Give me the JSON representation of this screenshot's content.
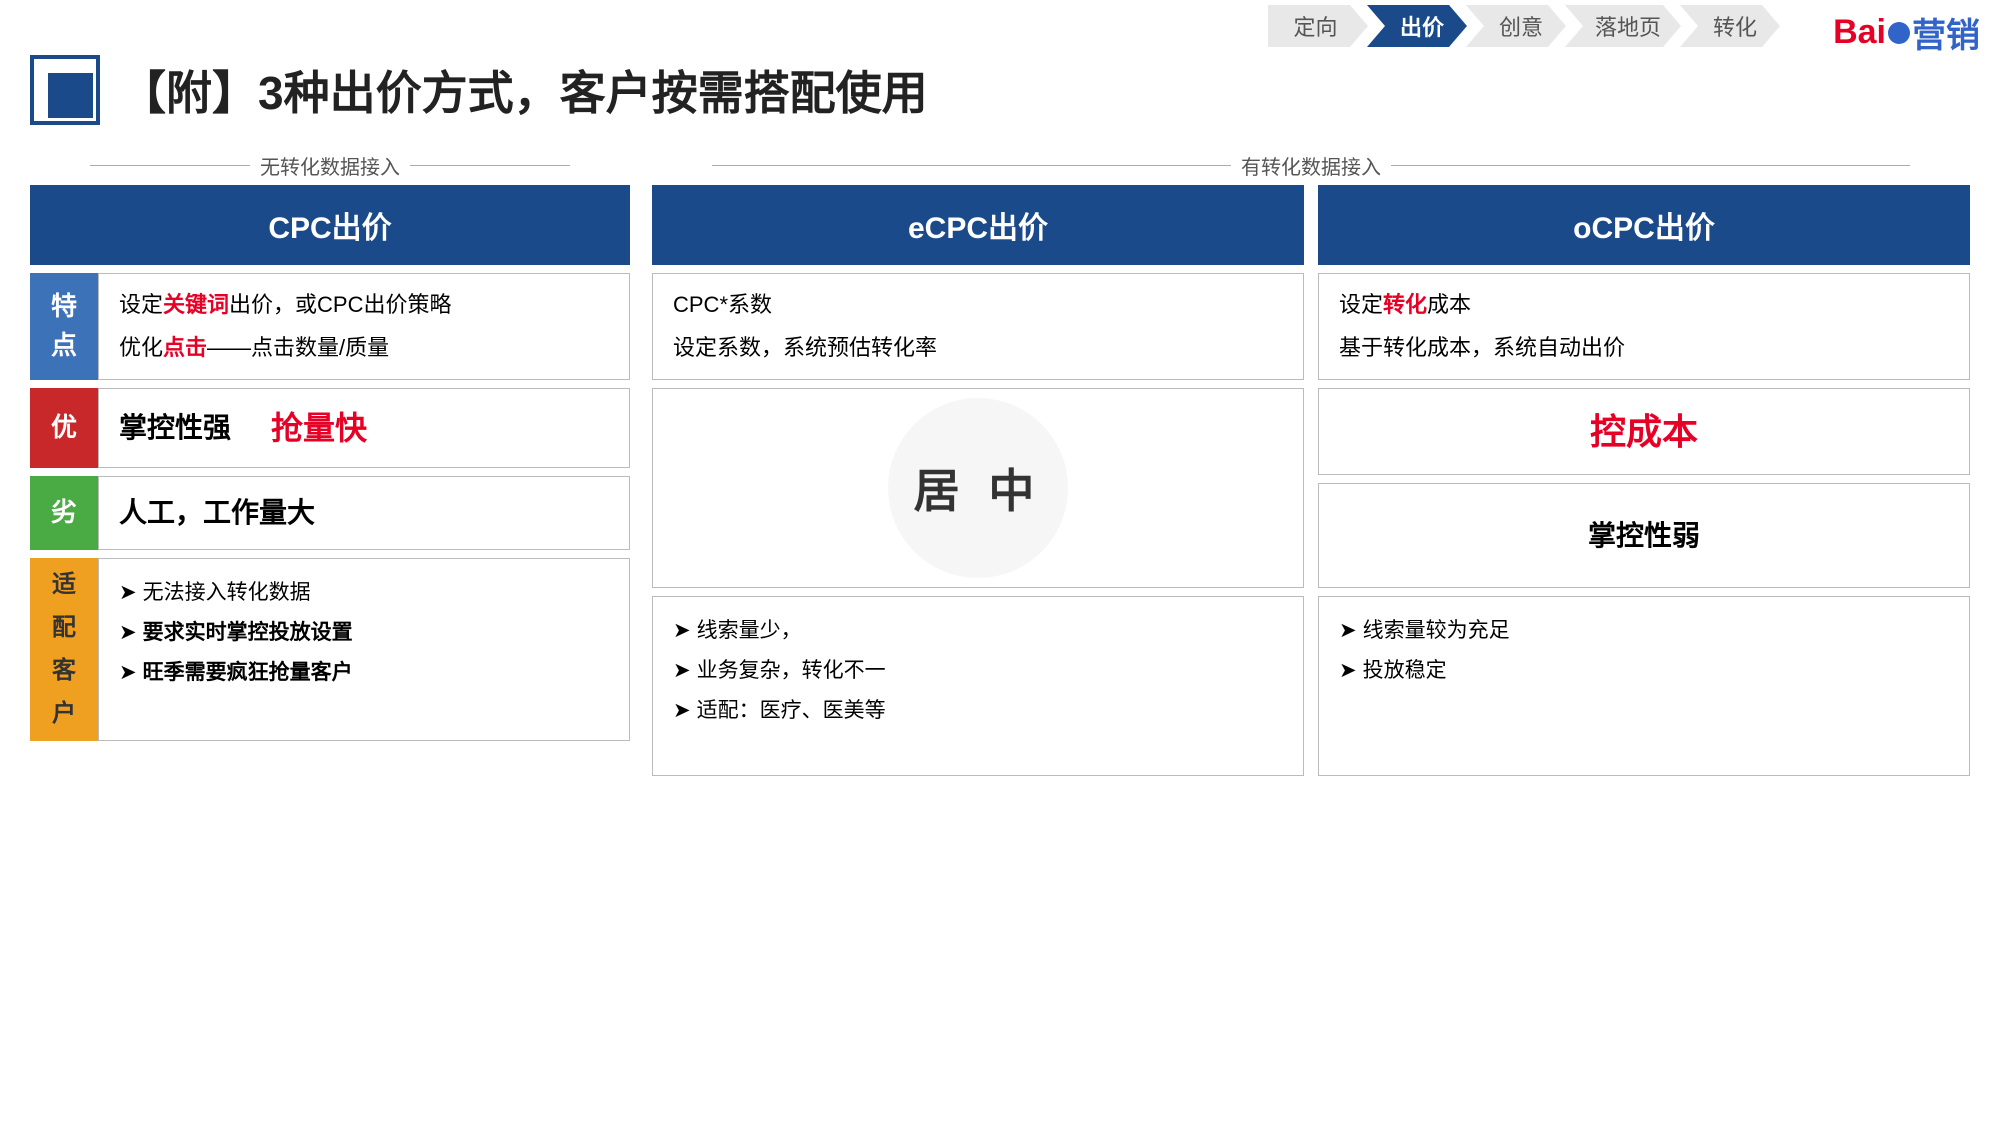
{
  "nav": {
    "steps": [
      {
        "label": "定向",
        "active": false
      },
      {
        "label": "出价",
        "active": true
      },
      {
        "label": "创意",
        "active": false
      },
      {
        "label": "落地页",
        "active": false
      },
      {
        "label": "转化",
        "active": false
      }
    ]
  },
  "logo": {
    "text": "Bai du营销"
  },
  "title": "【附】3种出价方式，客户按需搭配使用",
  "section_left_label": "无转化数据接入",
  "section_right_label": "有转化数据接入",
  "cpc": {
    "header": "CPC出价",
    "feature_line1": "设定",
    "feature_keyword": "关键词",
    "feature_line1_after": "出价，或CPC出价策略",
    "feature_line2_pre": "优化",
    "feature_click": "点击",
    "feature_line2_after": "——点击数量/质量",
    "advantage_label": "优",
    "advantage_text1": "掌控性强",
    "advantage_text2_red": "抢量快",
    "disadvantage_label": "劣",
    "disadvantage_text": "人工，工作量大",
    "fit_label_chars": [
      "适",
      "配",
      "客",
      "户"
    ],
    "fit_items": [
      "无法接入转化数据",
      "要求实时掌控投放设置",
      "旺季需要疯狂抢量客户"
    ]
  },
  "ecpc": {
    "header": "eCPC出价",
    "feature_line1": "CPC*系数",
    "feature_line2": "设定系数，系统预估转化率",
    "middle_text": "居 中",
    "fit_items": [
      "线索量少，",
      "业务复杂，转化不一",
      "适配：医疗、医美等"
    ]
  },
  "ocpc": {
    "header": "oCPC出价",
    "feature_line1_pre": "设定",
    "feature_zhuanhua": "转化",
    "feature_line1_after": "成本",
    "feature_line2": "基于转化成本，系统自动出价",
    "advantage_red": "控成本",
    "disadvantage_text": "掌控性弱",
    "fit_items": [
      "线索量较为充足",
      "投放稳定"
    ]
  },
  "labels": {
    "te_chars": [
      "特",
      "点"
    ],
    "you": "优",
    "lao": "劣",
    "shi_chars": [
      "适",
      "配",
      "客",
      "户"
    ]
  }
}
